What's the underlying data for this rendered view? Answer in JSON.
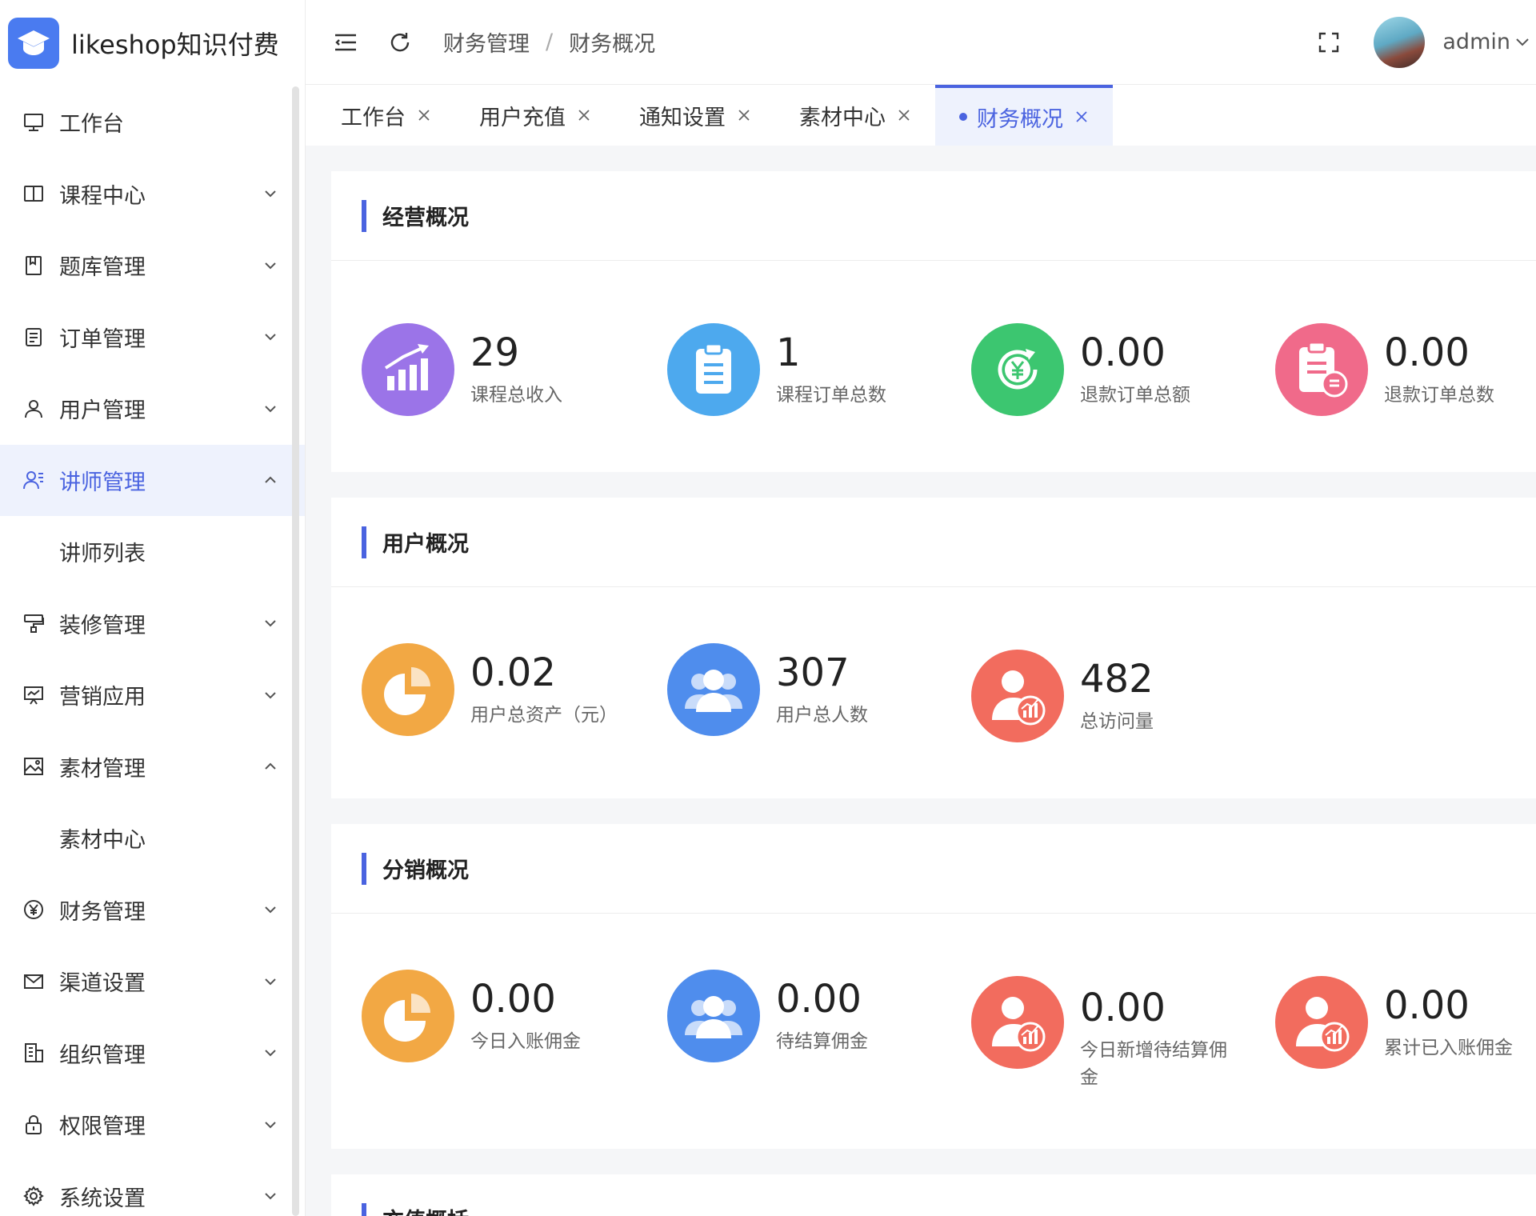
{
  "app": {
    "name": "likeshop知识付费"
  },
  "sidebar": {
    "items": [
      {
        "label": "工作台",
        "icon": "monitor-icon"
      },
      {
        "label": "课程中心",
        "icon": "book-icon"
      },
      {
        "label": "题库管理",
        "icon": "question-bank-icon"
      },
      {
        "label": "订单管理",
        "icon": "order-icon"
      },
      {
        "label": "用户管理",
        "icon": "user-icon"
      },
      {
        "label": "讲师管理",
        "icon": "teacher-icon"
      },
      {
        "label": "讲师列表"
      },
      {
        "label": "装修管理",
        "icon": "decoration-icon"
      },
      {
        "label": "营销应用",
        "icon": "marketing-icon"
      },
      {
        "label": "素材管理",
        "icon": "image-icon"
      },
      {
        "label": "素材中心"
      },
      {
        "label": "财务管理",
        "icon": "yen-icon"
      },
      {
        "label": "渠道设置",
        "icon": "mail-icon"
      },
      {
        "label": "组织管理",
        "icon": "organization-icon"
      },
      {
        "label": "权限管理",
        "icon": "lock-icon"
      },
      {
        "label": "系统设置",
        "icon": "gear-icon"
      }
    ]
  },
  "header": {
    "breadcrumb": [
      "财务管理",
      "财务概况"
    ],
    "user": "admin"
  },
  "tabs": [
    "工作台",
    "用户充值",
    "通知设置",
    "素材中心",
    "财务概况"
  ],
  "sections": [
    {
      "title": "经营概况",
      "stats": [
        {
          "value": "29",
          "label": "课程总收入",
          "icon": "revenue-chart-icon",
          "color": "#9b74e8"
        },
        {
          "value": "1",
          "label": "课程订单总数",
          "icon": "clipboard-icon",
          "color": "#4da9ee"
        },
        {
          "value": "0.00",
          "label": "退款订单总额",
          "icon": "refund-yen-icon",
          "color": "#3cc670"
        },
        {
          "value": "0.00",
          "label": "退款订单总数",
          "icon": "refund-clipboard-icon",
          "color": "#f06a8a"
        }
      ]
    },
    {
      "title": "用户概况",
      "stats": [
        {
          "value": "0.02",
          "label": "用户总资产（元）",
          "icon": "pie-chart-icon",
          "color": "#f2a844"
        },
        {
          "value": "307",
          "label": "用户总人数",
          "icon": "users-icon",
          "color": "#4f8ded"
        },
        {
          "value": "482",
          "label": "总访问量",
          "icon": "user-analytics-icon",
          "color": "#f26c5e"
        }
      ]
    },
    {
      "title": "分销概况",
      "stats": [
        {
          "value": "0.00",
          "label": "今日入账佣金",
          "icon": "pie-chart-icon",
          "color": "#f2a844"
        },
        {
          "value": "0.00",
          "label": "待结算佣金",
          "icon": "users-icon",
          "color": "#4f8ded"
        },
        {
          "value": "0.00",
          "label": "今日新增待结算佣金",
          "icon": "user-analytics-icon",
          "color": "#f26c5e"
        },
        {
          "value": "0.00",
          "label": "累计已入账佣金",
          "icon": "user-analytics-icon",
          "color": "#f26c5e"
        }
      ]
    },
    {
      "title": "充值概括"
    }
  ]
}
